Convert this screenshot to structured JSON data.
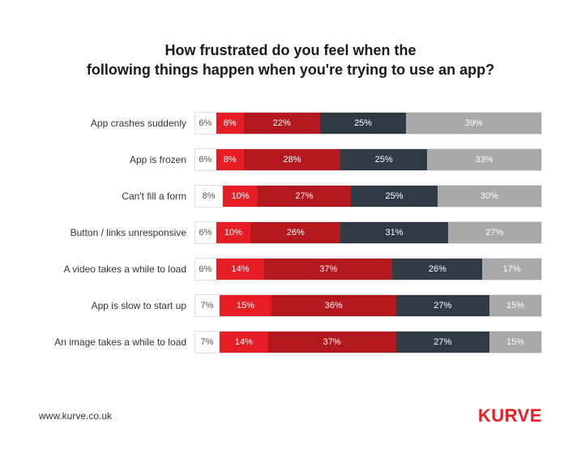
{
  "title_line1": "How frustrated do you feel when the",
  "title_line2": "following things happen when you're trying to use an app?",
  "footer_url": "www.kurve.co.uk",
  "brand": "KURVE",
  "colors": {
    "seg0": "#ffffff",
    "seg1": "#e71d25",
    "seg2": "#b3181e",
    "seg3": "#2f3a44",
    "seg4": "#a9a9a9",
    "brand": "#e71d25"
  },
  "chart_data": {
    "type": "bar",
    "stacked": true,
    "orientation": "horizontal",
    "title": "How frustrated do you feel when the following things happen when you're trying to use an app?",
    "xlabel": "",
    "ylabel": "",
    "xlim": [
      0,
      100
    ],
    "categories": [
      "App crashes suddenly",
      "App is frozen",
      "Can't fill a form",
      "Button / links unresponsive",
      "A video takes a while to load",
      "App is slow to start up",
      "An image takes a while to load"
    ],
    "series": [
      {
        "name": "Level 1",
        "values": [
          6,
          6,
          8,
          6,
          6,
          7,
          7
        ]
      },
      {
        "name": "Level 2",
        "values": [
          8,
          8,
          10,
          10,
          14,
          15,
          14
        ]
      },
      {
        "name": "Level 3",
        "values": [
          22,
          28,
          27,
          26,
          37,
          36,
          37
        ]
      },
      {
        "name": "Level 4",
        "values": [
          25,
          25,
          25,
          31,
          26,
          27,
          27
        ]
      },
      {
        "name": "Level 5",
        "values": [
          39,
          33,
          30,
          27,
          17,
          15,
          15
        ]
      }
    ]
  }
}
